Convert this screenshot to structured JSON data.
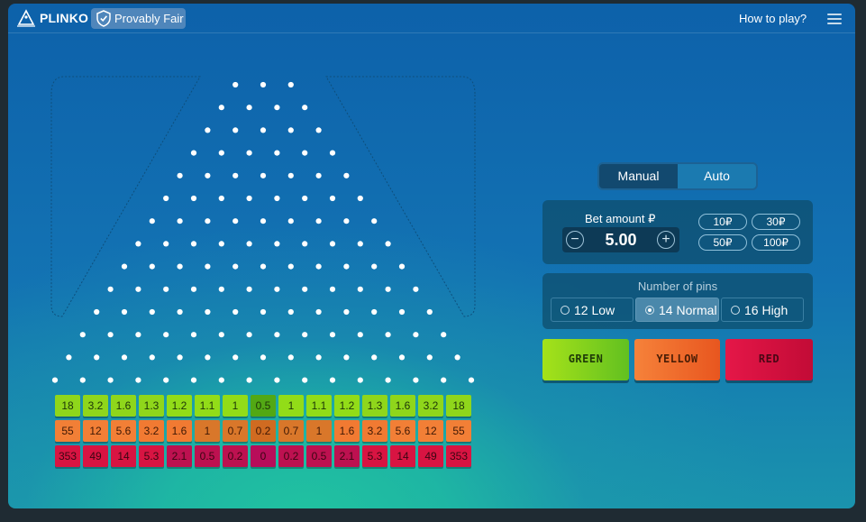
{
  "header": {
    "logo_text": "PLINKO",
    "provably_fair": "Provably Fair",
    "how_to_play": "How to play?"
  },
  "icons": {
    "logo": "plinko-triangle-icon",
    "badge": "shield-check-icon",
    "menu": "hamburger-menu-icon",
    "decrease": "minus-circle-icon",
    "increase": "plus-circle-icon"
  },
  "colors": {
    "green": "#8fd21b",
    "yellow": "#f3712d",
    "red": "#d8123f",
    "panel": "#0e4c69",
    "background_top": "#0d61aa",
    "background_glow": "#20c2a0"
  },
  "board": {
    "pin_rows": [
      3,
      4,
      5,
      6,
      7,
      8,
      9,
      10,
      11,
      12,
      13,
      14,
      15,
      16
    ],
    "multipliers": {
      "green": [
        "18",
        "3.2",
        "1.6",
        "1.3",
        "1.2",
        "1.1",
        "1",
        "0.5",
        "1",
        "1.1",
        "1.2",
        "1.3",
        "1.6",
        "3.2",
        "18"
      ],
      "yellow": [
        "55",
        "12",
        "5.6",
        "3.2",
        "1.6",
        "1",
        "0.7",
        "0.2",
        "0.7",
        "1",
        "1.6",
        "3.2",
        "5.6",
        "12",
        "55"
      ],
      "red": [
        "353",
        "49",
        "14",
        "5.3",
        "2.1",
        "0.5",
        "0.2",
        "0",
        "0.2",
        "0.5",
        "2.1",
        "5.3",
        "14",
        "49",
        "353"
      ]
    }
  },
  "controls": {
    "mode": {
      "manual": "Manual",
      "auto": "Auto",
      "selected": "Manual"
    },
    "bet": {
      "label": "Bet amount ₽",
      "value": "5.00",
      "minus": "−",
      "plus": "+",
      "chips": [
        "10₽",
        "30₽",
        "50₽",
        "100₽"
      ]
    },
    "pins": {
      "title": "Number of pins",
      "options": [
        "12 Low",
        "14 Normal",
        "16 High"
      ],
      "selected": "14 Normal"
    },
    "play_buttons": {
      "green": "GREEN",
      "yellow": "YELLOW",
      "red": "RED"
    }
  }
}
